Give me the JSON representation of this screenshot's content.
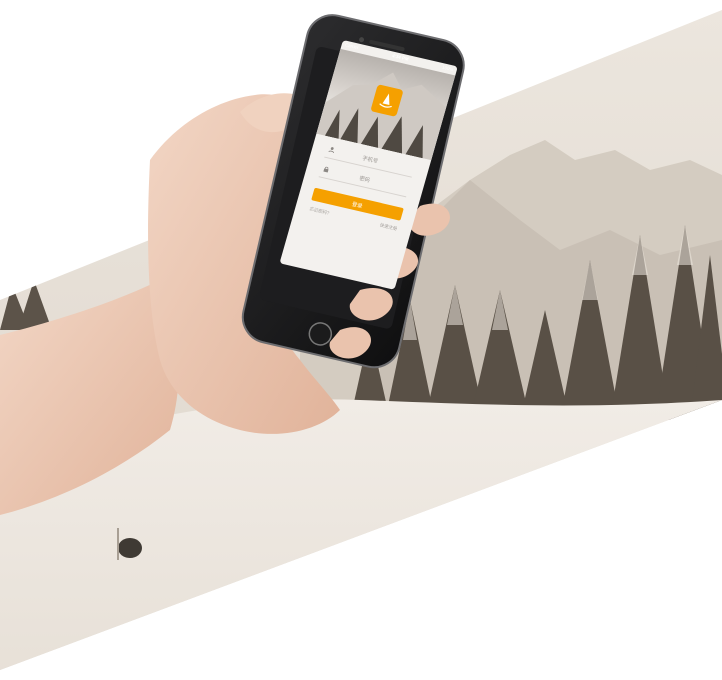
{
  "status_bar": {
    "carrier": "Carrier",
    "time": "4:34 PM",
    "battery": "100%"
  },
  "login": {
    "phone_placeholder": "手机号",
    "password_placeholder": "密码",
    "login_button": "登录",
    "forgot_link": "忘记密码?",
    "register_link": "快速注册"
  },
  "icons": {
    "logo": "orange-sail-logo-icon",
    "phone": "user-icon",
    "password": "lock-icon"
  },
  "colors": {
    "accent": "#f5a000",
    "background_sepia": "#d9d2c8",
    "background_white": "#ffffff"
  }
}
